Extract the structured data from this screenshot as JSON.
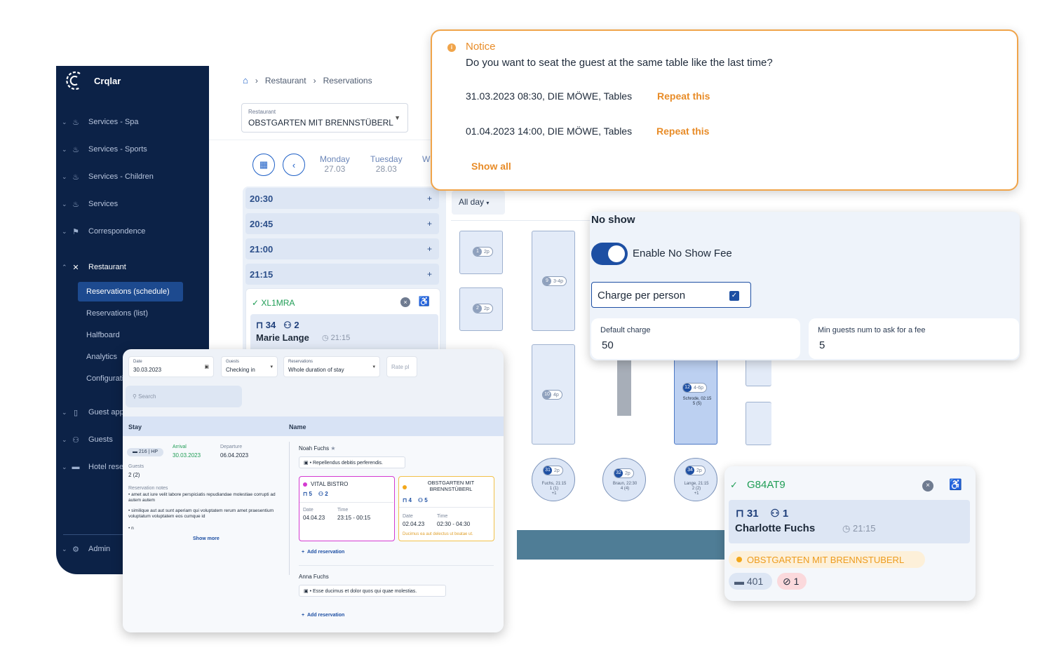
{
  "app": {
    "logo_text": "Crqlar",
    "sidebar": {
      "items": [
        {
          "label": "Services - Spa"
        },
        {
          "label": "Services - Sports"
        },
        {
          "label": "Services - Children"
        },
        {
          "label": "Services"
        },
        {
          "label": "Correspondence"
        },
        {
          "label": "Restaurant"
        },
        {
          "label": "Guest app"
        },
        {
          "label": "Guests"
        },
        {
          "label": "Hotel reservations"
        },
        {
          "label": "Admin"
        }
      ],
      "subitems": [
        {
          "label": "Reservations (schedule)"
        },
        {
          "label": "Reservations (list)"
        },
        {
          "label": "Halfboard"
        },
        {
          "label": "Analytics"
        },
        {
          "label": "Configuration"
        }
      ]
    },
    "breadcrumb": [
      "Restaurant",
      "Reservations"
    ],
    "restaurant_select": {
      "label": "Restaurant",
      "value": "OBSTGARTEN MIT BRENNSTÜBERL"
    },
    "days": [
      {
        "name": "Monday",
        "date": "27.03"
      },
      {
        "name": "Tuesday",
        "date": "28.03"
      },
      {
        "name": "W",
        "date": ""
      }
    ],
    "slots": [
      "20:30",
      "20:45",
      "21:00",
      "21:15"
    ],
    "reservation": {
      "code": "XL1MRA",
      "table": "34",
      "guests": "2",
      "name": "Marie Lange",
      "time": "21:15"
    },
    "filter": {
      "label": "All day"
    },
    "tables": [
      {
        "num": "1",
        "cap": "2p"
      },
      {
        "num": "2",
        "cap": "2p"
      },
      {
        "num": "9",
        "cap": "3-4p"
      },
      {
        "num": "10",
        "cap": "4p"
      },
      {
        "num": "12",
        "cap": "4-6p",
        "note": "Schrode, 02:15",
        "note2": "5 (5)"
      },
      {
        "num": "31",
        "cap": "2p",
        "note": "Fuchs, 21:15",
        "note2": "1 (1)",
        "note3": "+1"
      },
      {
        "num": "32",
        "cap": "2p",
        "note": "Braun, 22:30",
        "note2": "4 (4)"
      },
      {
        "num": "34",
        "cap": "2p",
        "note": "Lange, 21:15",
        "note2": "2 (2)",
        "note3": "+1"
      }
    ]
  },
  "notice": {
    "title": "Notice",
    "message": "Do you want to seat the guest at the same table like the last time?",
    "rows": [
      {
        "text": "31.03.2023 08:30, DIE MÖWE, Tables",
        "action": "Repeat this"
      },
      {
        "text": "01.04.2023 14:00, DIE MÖWE, Tables",
        "action": "Repeat this"
      }
    ],
    "show_all": "Show all"
  },
  "no_show": {
    "title": "No show",
    "toggle_label": "Enable No Show Fee",
    "toggle_on": true,
    "charge_per_person": "Charge per person",
    "charge_checked": true,
    "default_charge": {
      "label": "Default charge",
      "value": "50"
    },
    "min_guests": {
      "label": "Min guests num to ask for a fee",
      "value": "5"
    }
  },
  "stay_list": {
    "filters": [
      {
        "label": "Date",
        "value": "30.03.2023"
      },
      {
        "label": "Guests",
        "value": "Checking in"
      },
      {
        "label": "Reservations",
        "value": "Whole duration of stay"
      },
      {
        "label": "",
        "value": "Rate pl"
      }
    ],
    "search_placeholder": "Search",
    "columns": [
      "Stay",
      "Name"
    ],
    "stay": {
      "room": "216 | HP",
      "arrival_label": "Arrival",
      "arrival": "30.03.2023",
      "departure_label": "Departure",
      "departure": "06.04.2023",
      "guests_label": "Guests",
      "guests": "2 (2)",
      "notes_label": "Reservation notes",
      "note1": "• amet aut iure velit labore perspiciatis repudiandae molestiae corrupti ad autem autem",
      "note2": "• similique aut aut sunt aperiam qui voluptatem rerum amet praesentium voluptatum voluptatem eos cumque id",
      "note3": "• n",
      "show_more": "Show more"
    },
    "guest1": {
      "name": "Noah Fuchs",
      "note": "• Repellendus debitis perferendis.",
      "cards": [
        {
          "restaurant": "VITAL BISTRO",
          "table": "5",
          "guests": "2",
          "date_label": "Date",
          "date": "04.04.23",
          "time_label": "Time",
          "time": "23:15 - 00:15",
          "extra": "",
          "color": "#d43ad1"
        },
        {
          "restaurant": "OBSTGARTEN MIT BRENNSTÜBERL",
          "table": "4",
          "guests": "5",
          "date_label": "Date",
          "date": "02.04.23",
          "time_label": "Time",
          "time": "02:30 - 04:30",
          "extra": "Ducimus ea aut delectus ut beatae ut.",
          "color": "#f2a71b"
        }
      ],
      "add": "Add reservation"
    },
    "guest2": {
      "name": "Anna Fuchs",
      "note": "• Esse ducimus et dolor quos qui quae molestias.",
      "add": "Add reservation"
    }
  },
  "popup": {
    "code": "G84AT9",
    "table": "31",
    "guests": "1",
    "name": "Charlotte Fuchs",
    "time": "21:15",
    "restaurant": "OBSTGARTEN MIT BRENNSTUBERL",
    "room": "401",
    "no_alcohol": "1"
  },
  "colors": {
    "brand_navy": "#0c2247",
    "accent_blue": "#1d4fa3",
    "notice_orange": "#e88c28",
    "success_green": "#1f9d55"
  }
}
